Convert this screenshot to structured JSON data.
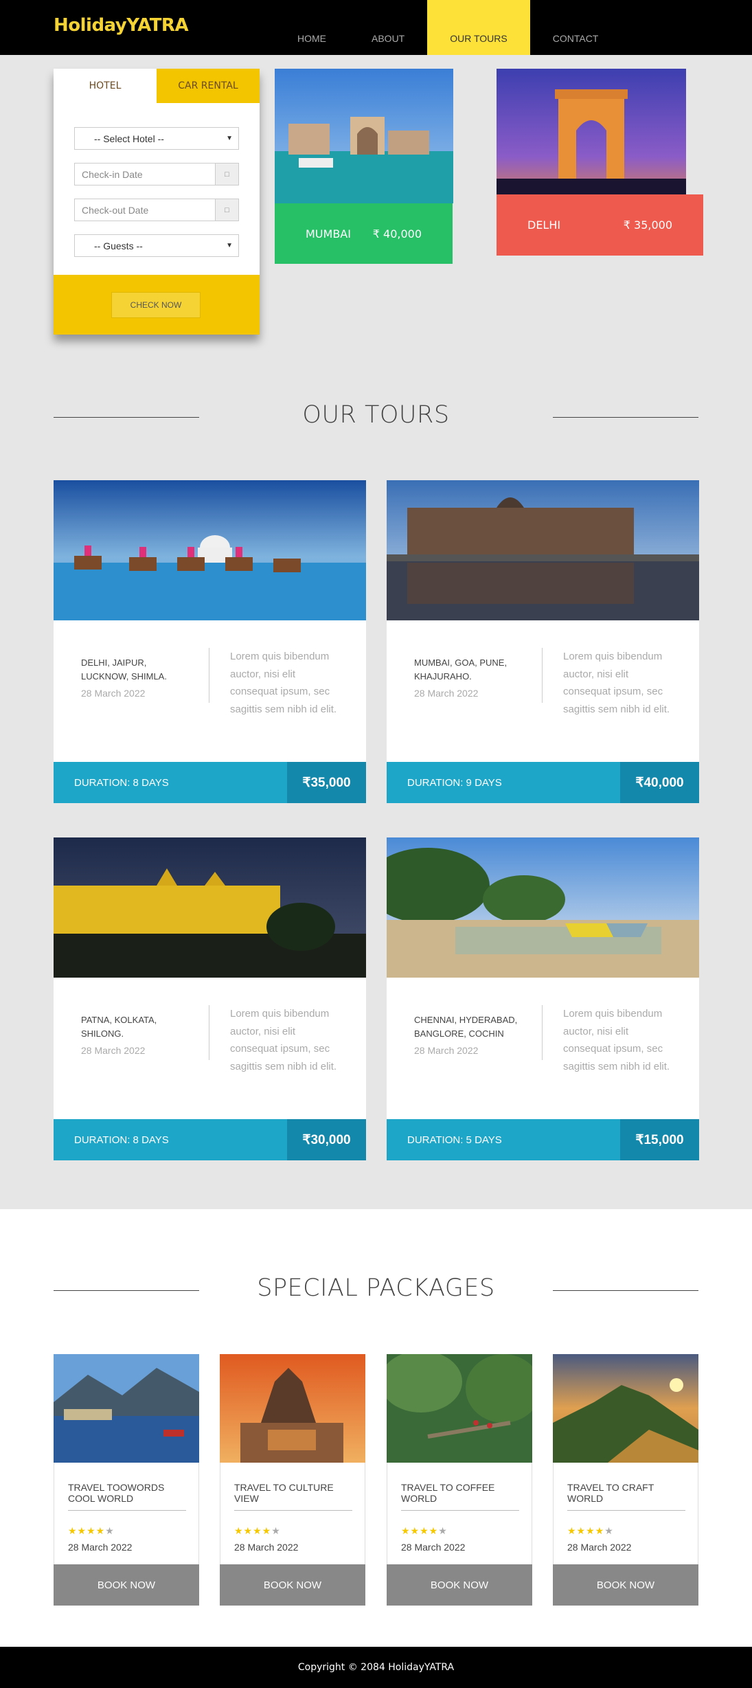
{
  "header": {
    "logo": "HolidayYATRA",
    "nav": [
      {
        "label": "HOME",
        "active": false
      },
      {
        "label": "ABOUT",
        "active": false
      },
      {
        "label": "OUR TOURS",
        "active": true
      },
      {
        "label": "CONTACT",
        "active": false
      }
    ]
  },
  "booking": {
    "tabs": [
      "HOTEL",
      "CAR RENTAL"
    ],
    "hotel_select": "-- Select Hotel --",
    "checkin_placeholder": "Check-in Date",
    "checkout_placeholder": "Check-out Date",
    "guests_select": "-- Guests --",
    "check_button": "CHECK NOW"
  },
  "destinations": [
    {
      "city": "MUMBAI",
      "price": "₹ 40,000",
      "color": "#27c066"
    },
    {
      "city": "DELHI",
      "price": "₹ 35,000",
      "color": "#ee5a4e"
    }
  ],
  "tours_section": {
    "title": "OUR TOURS",
    "tours": [
      {
        "cities": "DELHI, JAIPUR, LUCKNOW, SHIMLA.",
        "date": "28 March 2022",
        "desc": "Lorem quis bibendum auctor, nisi elit consequat ipsum, sec sagittis sem nibh id elit.",
        "duration": "DURATION: 8 DAYS",
        "price": "₹35,000"
      },
      {
        "cities": "MUMBAI, GOA, PUNE, KHAJURAHO.",
        "date": "28 March 2022",
        "desc": "Lorem quis bibendum auctor, nisi elit consequat ipsum, sec sagittis sem nibh id elit.",
        "duration": "DURATION: 9 DAYS",
        "price": "₹40,000"
      },
      {
        "cities": "PATNA, KOLKATA, SHILONG.",
        "date": "28 March 2022",
        "desc": "Lorem quis bibendum auctor, nisi elit consequat ipsum, sec sagittis sem nibh id elit.",
        "duration": "DURATION: 8 DAYS",
        "price": "₹30,000"
      },
      {
        "cities": "CHENNAI, HYDERABAD, BANGLORE, COCHIN",
        "date": "28 March 2022",
        "desc": "Lorem quis bibendum auctor, nisi elit consequat ipsum, sec sagittis sem nibh id elit.",
        "duration": "DURATION: 5 DAYS",
        "price": "₹15,000"
      }
    ]
  },
  "packages_section": {
    "title": "SPECIAL PACKAGES",
    "packages": [
      {
        "title": "TRAVEL TOOWORDS COOL WORLD",
        "rating": 4,
        "date": "28 March 2022",
        "button": "BOOK NOW"
      },
      {
        "title": "TRAVEL TO CULTURE VIEW",
        "rating": 4,
        "date": "28 March 2022",
        "button": "BOOK NOW"
      },
      {
        "title": "TRAVEL TO COFFEE WORLD",
        "rating": 4,
        "date": "28 March 2022",
        "button": "BOOK NOW"
      },
      {
        "title": "TRAVEL TO CRAFT WORLD",
        "rating": 4,
        "date": "28 March 2022",
        "button": "BOOK NOW"
      }
    ]
  },
  "footer": {
    "copyright": "Copyright © 2084 HolidayYATRA"
  },
  "colors": {
    "accent_yellow": "#fde038",
    "tour_blue": "#1ea6c9",
    "tour_price_blue": "#1488aa",
    "button_gray": "#888888"
  }
}
